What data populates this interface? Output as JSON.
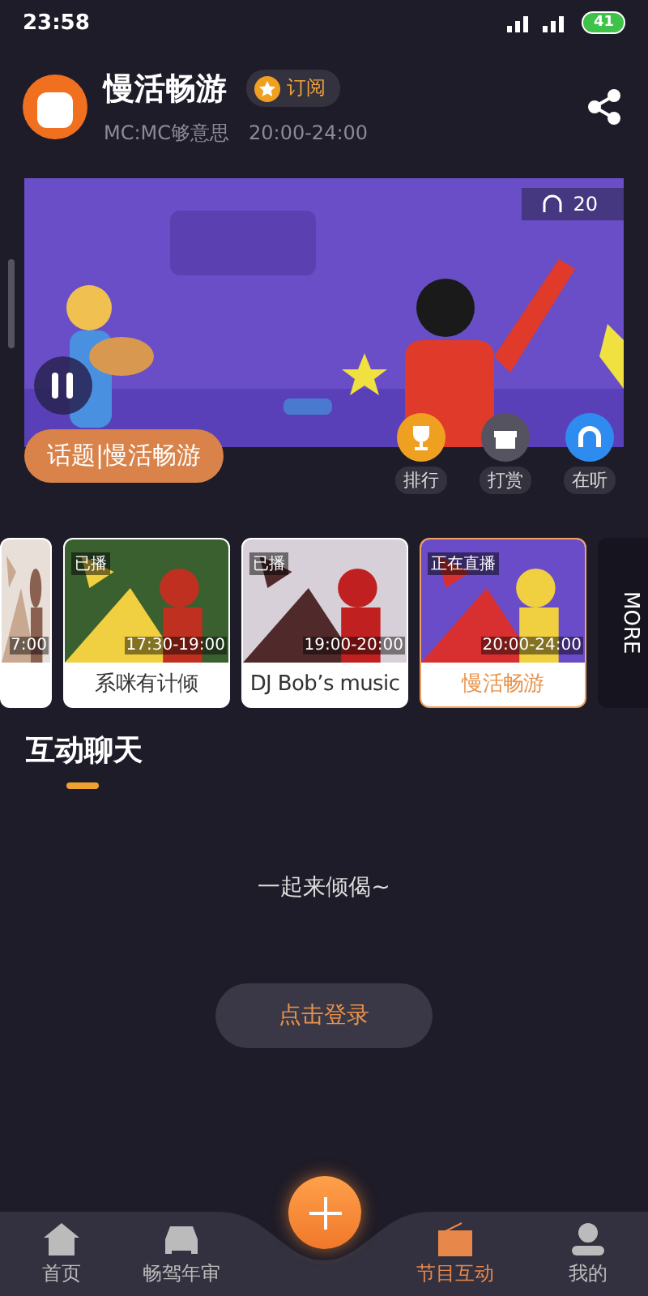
{
  "status_bar": {
    "time": "23:58",
    "battery": "41"
  },
  "header": {
    "title": "慢活畅游",
    "subscribe": "订阅",
    "host": "MC:MC够意思",
    "time": "20:00-24:00"
  },
  "banner": {
    "listeners": "20",
    "playing": true,
    "topic": "话题|慢活畅游",
    "actions": [
      {
        "label": "排行",
        "kind": "trophy"
      },
      {
        "label": "打赏",
        "kind": "gift"
      },
      {
        "label": "在听",
        "kind": "headphones"
      }
    ]
  },
  "programs": [
    {
      "time": "7:00",
      "selected": false
    },
    {
      "status": "已播",
      "time": "17:30-19:00",
      "title": "系咪有计倾",
      "selected": false
    },
    {
      "status": "已播",
      "time": "19:00-20:00",
      "title": "DJ Bob’s music",
      "selected": false
    },
    {
      "status": "正在直播",
      "time": "20:00-24:00",
      "title": "慢活畅游",
      "selected": true
    }
  ],
  "more": "MORE",
  "chat": {
    "title": "互动聊天",
    "empty": "一起来倾偈~",
    "login": "点击登录"
  },
  "nav": [
    {
      "label": "首页",
      "kind": "home",
      "selected": false
    },
    {
      "label": "畅驾年审",
      "kind": "car",
      "selected": false
    },
    {
      "label": "节目互动",
      "kind": "radio",
      "selected": true
    },
    {
      "label": "我的",
      "kind": "user",
      "selected": false
    }
  ]
}
